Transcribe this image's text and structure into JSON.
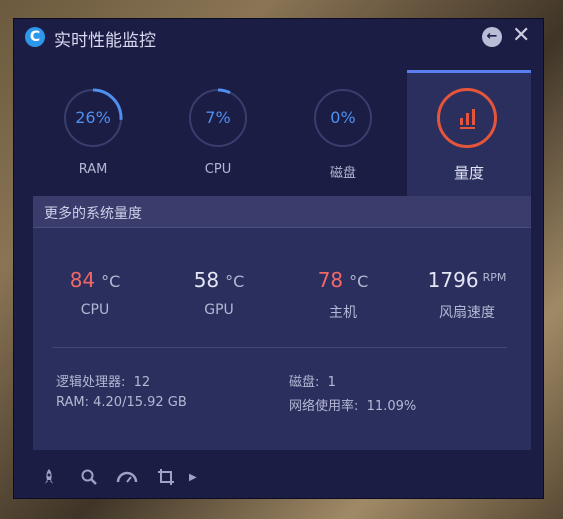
{
  "window": {
    "title": "实时性能监控",
    "logo_glyph": "C"
  },
  "tabs": [
    {
      "label": "RAM",
      "value": "26%",
      "percent": 26
    },
    {
      "label": "CPU",
      "value": "7%",
      "percent": 7
    },
    {
      "label": "磁盘",
      "value": "0%",
      "percent": 0
    },
    {
      "label": "量度",
      "icon": "bar-chart-icon"
    }
  ],
  "panel": {
    "title": "更多的系统量度",
    "metrics": [
      {
        "value": "84",
        "unit": "°C",
        "label": "CPU",
        "hot": true
      },
      {
        "value": "58",
        "unit": "°C",
        "label": "GPU",
        "hot": false
      },
      {
        "value": "78",
        "unit": "°C",
        "label": "主机",
        "hot": true
      },
      {
        "value": "1796",
        "unit": "RPM",
        "label": "风扇速度",
        "hot": false
      }
    ],
    "info": {
      "processors": "逻辑处理器:  12",
      "ram": "RAM: 4.20/15.92 GB",
      "disks": "磁盘:  1",
      "network": "网络使用率:  11.09%"
    }
  },
  "toolbar": [
    "rocket-icon",
    "search-icon",
    "speedometer-icon",
    "crop-icon",
    "chevron-right-icon"
  ],
  "colors": {
    "accent": "#4f8ff0",
    "hot": "#f06868",
    "gauge": "#e5553c",
    "background": "#1b1d44"
  }
}
